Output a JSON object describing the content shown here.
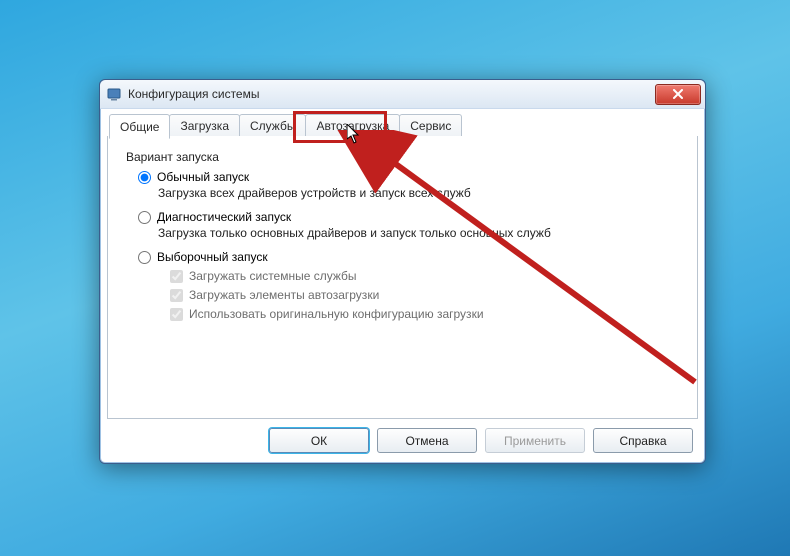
{
  "window": {
    "title": "Конфигурация системы"
  },
  "tabs": [
    {
      "id": "general",
      "label": "Общие",
      "active": true
    },
    {
      "id": "boot",
      "label": "Загрузка"
    },
    {
      "id": "services",
      "label": "Службы"
    },
    {
      "id": "startup",
      "label": "Автозагрузка",
      "highlighted": true
    },
    {
      "id": "tools",
      "label": "Сервис"
    }
  ],
  "general": {
    "group_label": "Вариант запуска",
    "opt1": {
      "label": "Обычный запуск",
      "desc": "Загрузка всех драйверов устройств и запуск всех служб",
      "checked": true
    },
    "opt2": {
      "label": "Диагностический запуск",
      "desc": "Загрузка только основных драйверов и запуск только основных служб",
      "checked": false
    },
    "opt3": {
      "label": "Выборочный запуск",
      "checked": false
    },
    "chk1": "Загружать системные службы",
    "chk2": "Загружать элементы автозагрузки",
    "chk3": "Использовать оригинальную конфигурацию загрузки"
  },
  "buttons": {
    "ok": "ОК",
    "cancel": "Отмена",
    "apply": "Применить",
    "help": "Справка"
  }
}
